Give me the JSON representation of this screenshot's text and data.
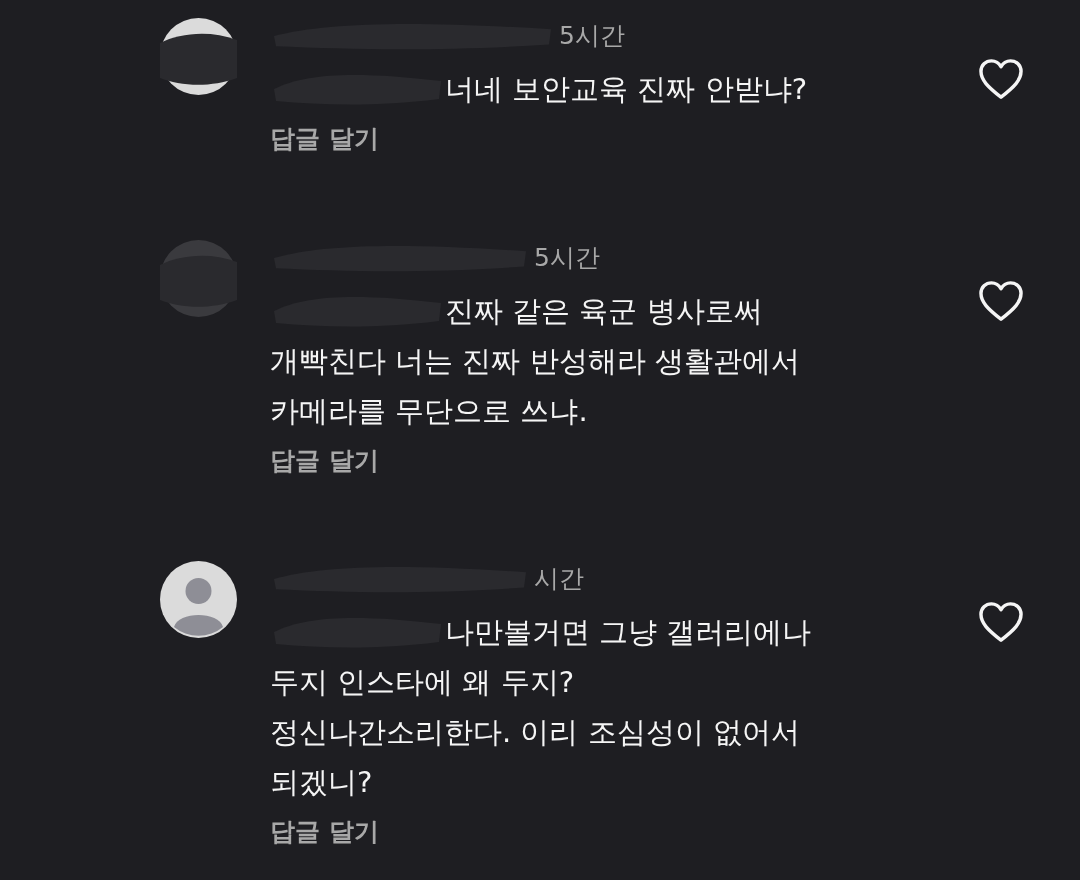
{
  "comments": [
    {
      "time": "5시간",
      "lines": [
        "너네 보안교육 진짜 안받냐?"
      ],
      "reply": "답글 달기",
      "liked": false
    },
    {
      "time": "5시간",
      "lines": [
        "진짜 같은 육군 병사로써",
        "개빡친다  너는 진짜 반성해라 생활관에서",
        "카메라를 무단으로 쓰냐."
      ],
      "reply": "답글 달기",
      "liked": false
    },
    {
      "time": "시간",
      "lines": [
        "나만볼거면  그냥 갤러리에나",
        "두지 인스타에  왜  두지?",
        "정신나간소리한다.  이리 조심성이 없어서",
        "되겠니?"
      ],
      "reply": "답글 달기",
      "liked": false
    }
  ]
}
